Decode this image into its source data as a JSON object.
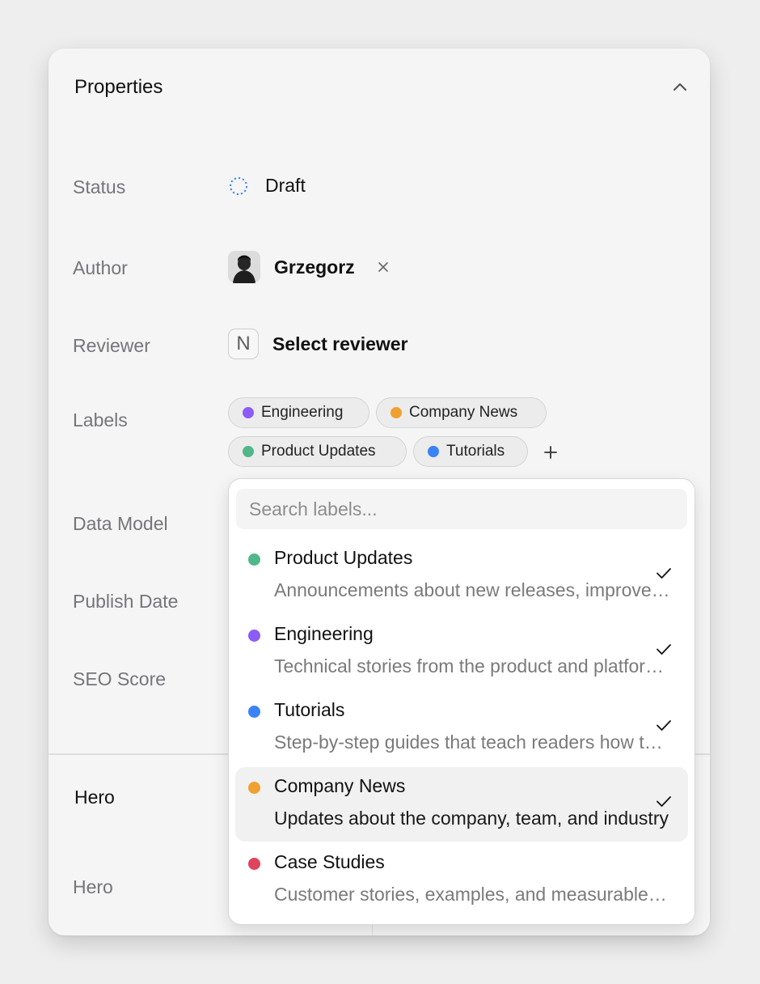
{
  "panel": {
    "title": "Properties",
    "collapse_icon": "chevron-up-icon",
    "properties": {
      "status": {
        "label": "Status",
        "value": "Draft",
        "icon": "draft-status-dashed-circle-icon",
        "icon_color": "#3b82f6"
      },
      "author": {
        "label": "Author",
        "value": "Grzegorz",
        "remove_icon": "close-icon"
      },
      "reviewer": {
        "label": "Reviewer",
        "placeholder": "Select reviewer",
        "icon_letter": "N"
      },
      "labels": {
        "label": "Labels",
        "chips": [
          {
            "name": "Engineering",
            "color": "#8b5cf6"
          },
          {
            "name": "Company News",
            "color": "#f0a030"
          },
          {
            "name": "Product Updates",
            "color": "#52b788"
          },
          {
            "name": "Tutorials",
            "color": "#3b82f6"
          }
        ],
        "add_icon": "plus-icon"
      },
      "data_model": {
        "label": "Data Model"
      },
      "publish_date": {
        "label": "Publish Date"
      },
      "seo_score": {
        "label": "SEO Score"
      }
    },
    "section": {
      "title": "Hero",
      "field_label": "Hero"
    }
  },
  "label_dropdown": {
    "search_placeholder": "Search labels...",
    "search_value": "",
    "options": [
      {
        "name": "Product Updates",
        "description": "Announcements about new releases, improvements, and product changes",
        "color": "#52b788",
        "selected": true,
        "highlighted": false
      },
      {
        "name": "Engineering",
        "description": "Technical stories from the product and platform teams",
        "color": "#8b5cf6",
        "selected": true,
        "highlighted": false
      },
      {
        "name": "Tutorials",
        "description": "Step-by-step guides that teach readers how to use the product",
        "color": "#3b82f6",
        "selected": true,
        "highlighted": false
      },
      {
        "name": "Company News",
        "description": "Updates about the company, team, and industry",
        "color": "#f0a030",
        "selected": true,
        "highlighted": true
      },
      {
        "name": "Case Studies",
        "description": "Customer stories, examples, and measurable results",
        "color": "#e0435c",
        "selected": false,
        "highlighted": false
      }
    ]
  }
}
